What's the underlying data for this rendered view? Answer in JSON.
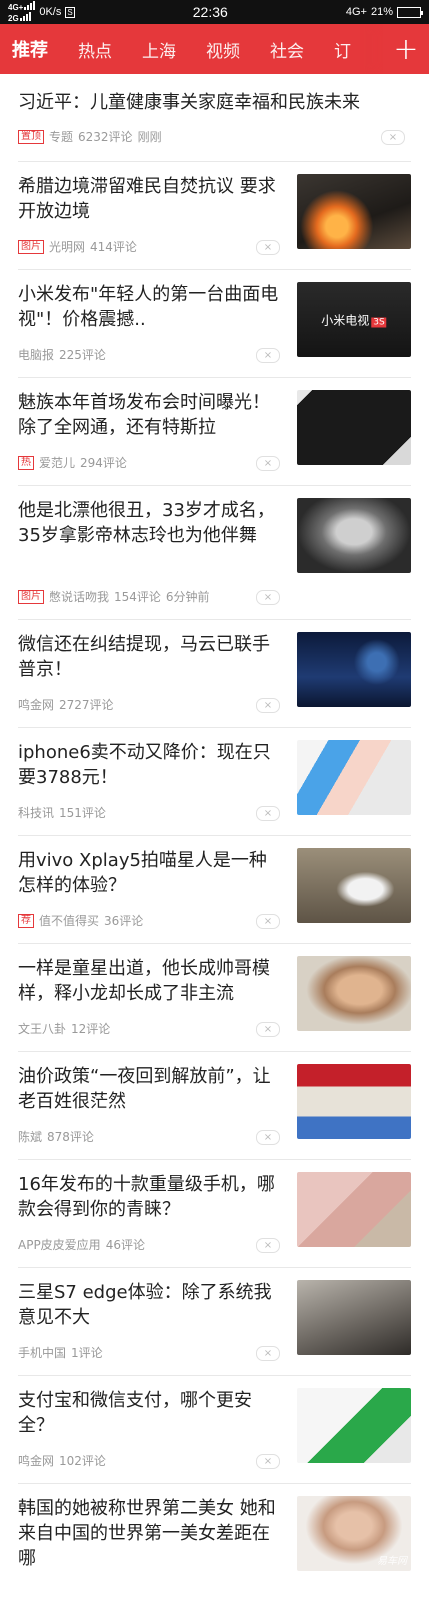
{
  "status": {
    "net_top": "4G+",
    "net_bottom": "2G",
    "speed": "0K/s",
    "sim_badge": "S",
    "time": "22:36",
    "net_right": "4G+",
    "battery": "21%",
    "battery_level": 0.21
  },
  "nav": {
    "tabs": [
      "推荐",
      "热点",
      "上海",
      "视频",
      "社会",
      "订"
    ],
    "active_index": 0,
    "add_symbol": "+"
  },
  "feed": [
    {
      "title": "习近平：儿童健康事关家庭幸福和民族未来",
      "tag": "置顶",
      "source": "专题",
      "comments": "6232评论",
      "time": "刚刚"
    },
    {
      "title": "希腊边境滞留难民自焚抗议 要求开放边境",
      "tag": "图片",
      "source": "光明网",
      "comments": "414评论",
      "thumb": "fire-protest-photo"
    },
    {
      "title": "小米发布\"年轻人的第一台曲面电视\"！价格震撼..",
      "source": "电脑报",
      "comments": "225评论",
      "thumb": "tv-promo-photo",
      "thumb_text": "小米电视",
      "thumb_badge": "3S"
    },
    {
      "title": "魅族本年首场发布会时间曝光！除了全网通，还有特斯拉",
      "tag": "热",
      "source": "爱范儿",
      "comments": "294评论",
      "thumb": "tv-screen-photo"
    },
    {
      "title": "他是北漂他很丑，33岁才成名，35岁拿影帝林志玲也为他伴舞",
      "tag": "图片",
      "source": "憋说话吻我",
      "comments": "154评论",
      "time": "6分钟前",
      "thumb": "child-portrait-photo"
    },
    {
      "title": "微信还在纠结提现，马云已联手普京！",
      "source": "鸣金网",
      "comments": "2727评论",
      "thumb": "stage-speaker-photo"
    },
    {
      "title": "iphone6卖不动又降价：现在只要3788元！",
      "source": "科技讯",
      "comments": "151评论",
      "thumb": "phones-photo"
    },
    {
      "title": "用vivo Xplay5拍喵星人是一种怎样的体验？",
      "tag": "荐",
      "source": "值不值得买",
      "comments": "36评论",
      "thumb": "cat-photo"
    },
    {
      "title": "一样是童星出道，他长成帅哥模样，释小龙却长成了非主流",
      "source": "文王八卦",
      "comments": "12评论",
      "thumb": "boy-portrait-photo"
    },
    {
      "title": "油价政策“一夜回到解放前”，让老百姓很茫然",
      "source": "陈斌",
      "comments": "878评论",
      "thumb": "gas-station-photo"
    },
    {
      "title": "16年发布的十款重量级手机，哪款会得到你的青睐？",
      "source": "APP皮皮爱应用",
      "comments": "46评论",
      "thumb": "pink-phone-photo"
    },
    {
      "title": "三星S7 edge体验：除了系统我意见不大",
      "source": "手机中国",
      "comments": "1评论",
      "thumb": "galaxy-phone-photo"
    },
    {
      "title": "支付宝和微信支付，哪个更安全？",
      "source": "鸣金网",
      "comments": "102评论",
      "thumb": "payment-app-photo"
    },
    {
      "title": "韩国的她被称世界第二美女 她和来自中国的世界第一美女差距在哪",
      "thumb": "woman-portrait-photo",
      "watermark": "易车网"
    }
  ],
  "colors": {
    "brand_red": "#e5383b",
    "meta_gray": "#999999",
    "divider": "#e8e8e8"
  },
  "dismiss_glyph": "×"
}
